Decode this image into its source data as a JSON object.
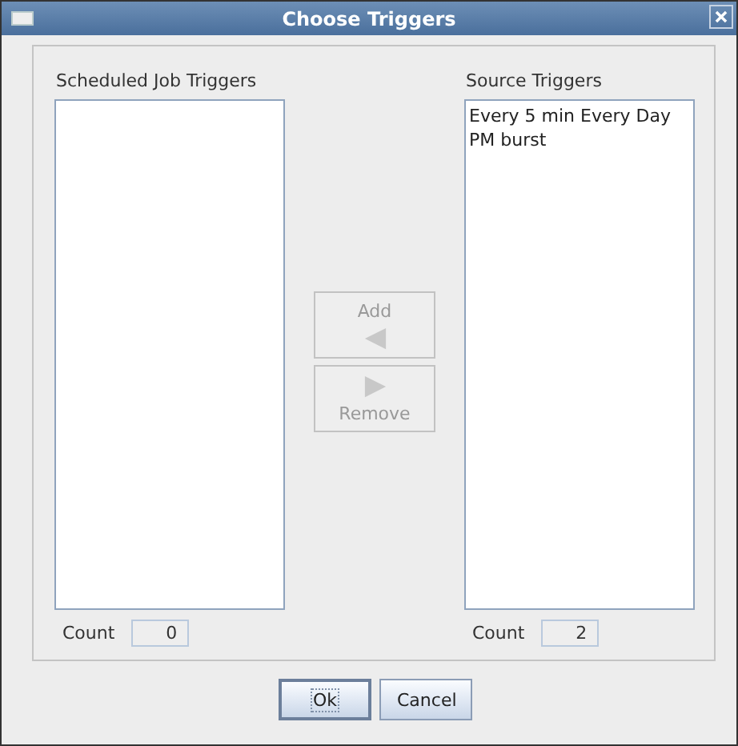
{
  "window": {
    "title": "Choose Triggers"
  },
  "lists": [
    {
      "label": "Scheduled Job Triggers",
      "count_label": "Count",
      "count": "0"
    },
    {
      "label": "Source Triggers",
      "items": [
        "Every 5  min Every Day",
        "PM burst"
      ],
      "count_label": "Count",
      "count": "2"
    }
  ],
  "transfer_buttons": [
    {
      "label": "Add",
      "kind": "left",
      "disabled": true
    },
    {
      "label": "Remove",
      "kind": "right",
      "disabled": true
    }
  ],
  "buttons": [
    {
      "label": "Ok",
      "focused": true
    },
    {
      "label": "Cancel",
      "focused": false
    }
  ]
}
